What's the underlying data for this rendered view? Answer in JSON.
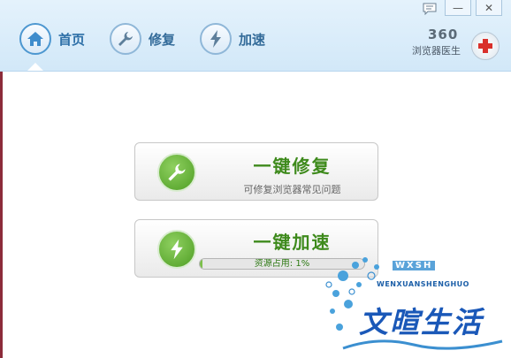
{
  "nav": {
    "home": {
      "label": "首页",
      "icon": "home-icon"
    },
    "repair": {
      "label": "修复",
      "icon": "wrench-icon"
    },
    "speed": {
      "label": "加速",
      "icon": "lightning-icon"
    }
  },
  "window": {
    "message_icon": "message-icon",
    "minimize_label": "—",
    "close_label": "✕"
  },
  "brand": {
    "number": "360",
    "name": "浏览器医生",
    "logo_icon": "first-aid-cross-icon"
  },
  "repair_card": {
    "title": "一键修复",
    "subtitle": "可修复浏览器常见问题",
    "icon": "wrench-icon"
  },
  "speed_card": {
    "title": "一键加速",
    "progress_text": "资源占用: 1%",
    "progress": 0.01,
    "icon": "lightning-icon"
  },
  "watermark": {
    "badge": "WXSH",
    "english": "WENXUANSHENGHUO",
    "chinese": "文暄生活"
  },
  "colors": {
    "accent_green": "#4e9e24",
    "header_blue": "#d2e8f8",
    "nav_blue": "#2d6fa7"
  }
}
